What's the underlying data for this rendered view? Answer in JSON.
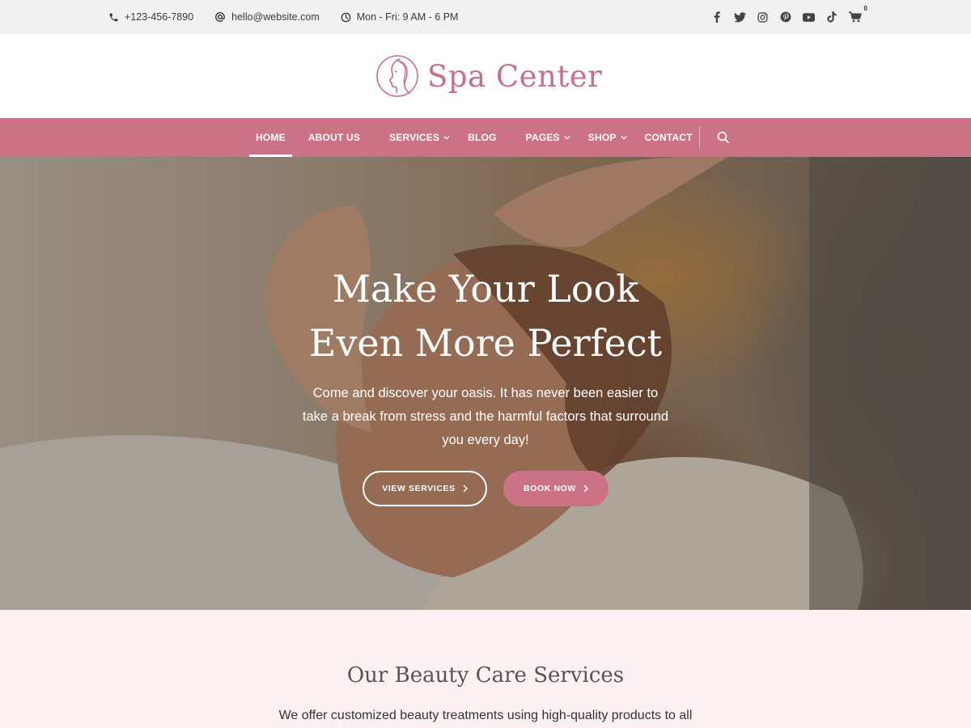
{
  "topbar": {
    "phone": "+123-456-7890",
    "email": "hello@website.com",
    "hours": "Mon - Fri: 9 AM - 6 PM",
    "social_icons": [
      "facebook-icon",
      "twitter-icon",
      "instagram-icon",
      "pinterest-icon",
      "youtube-icon",
      "tiktok-icon"
    ],
    "cart_count": "0"
  },
  "logo": {
    "text": "Spa Center"
  },
  "nav": {
    "items": [
      {
        "label": "HOME",
        "active": true,
        "dropdown": false
      },
      {
        "label": "ABOUT US",
        "active": false,
        "dropdown": false
      },
      {
        "label": "SERVICES",
        "active": false,
        "dropdown": true
      },
      {
        "label": "BLOG",
        "active": false,
        "dropdown": false
      },
      {
        "label": "PAGES",
        "active": false,
        "dropdown": true
      },
      {
        "label": "SHOP",
        "active": false,
        "dropdown": true
      },
      {
        "label": "CONTACT",
        "active": false,
        "dropdown": false
      }
    ]
  },
  "hero": {
    "title_line1": "Make Your Look",
    "title_line2": "Even More Perfect",
    "description": "Come and discover your oasis. It has never been easier to take a break from stress and the harmful factors that surround you every day!",
    "btn_services": "VIEW SERVICES",
    "btn_book": "BOOK NOW"
  },
  "services": {
    "heading": "Our Beauty Care Services",
    "intro": "We offer customized beauty treatments using high-quality products to all"
  },
  "colors": {
    "accent": "#cc7287",
    "topbar_bg": "#f1f1f1",
    "section_bg": "#fbf1f2"
  }
}
